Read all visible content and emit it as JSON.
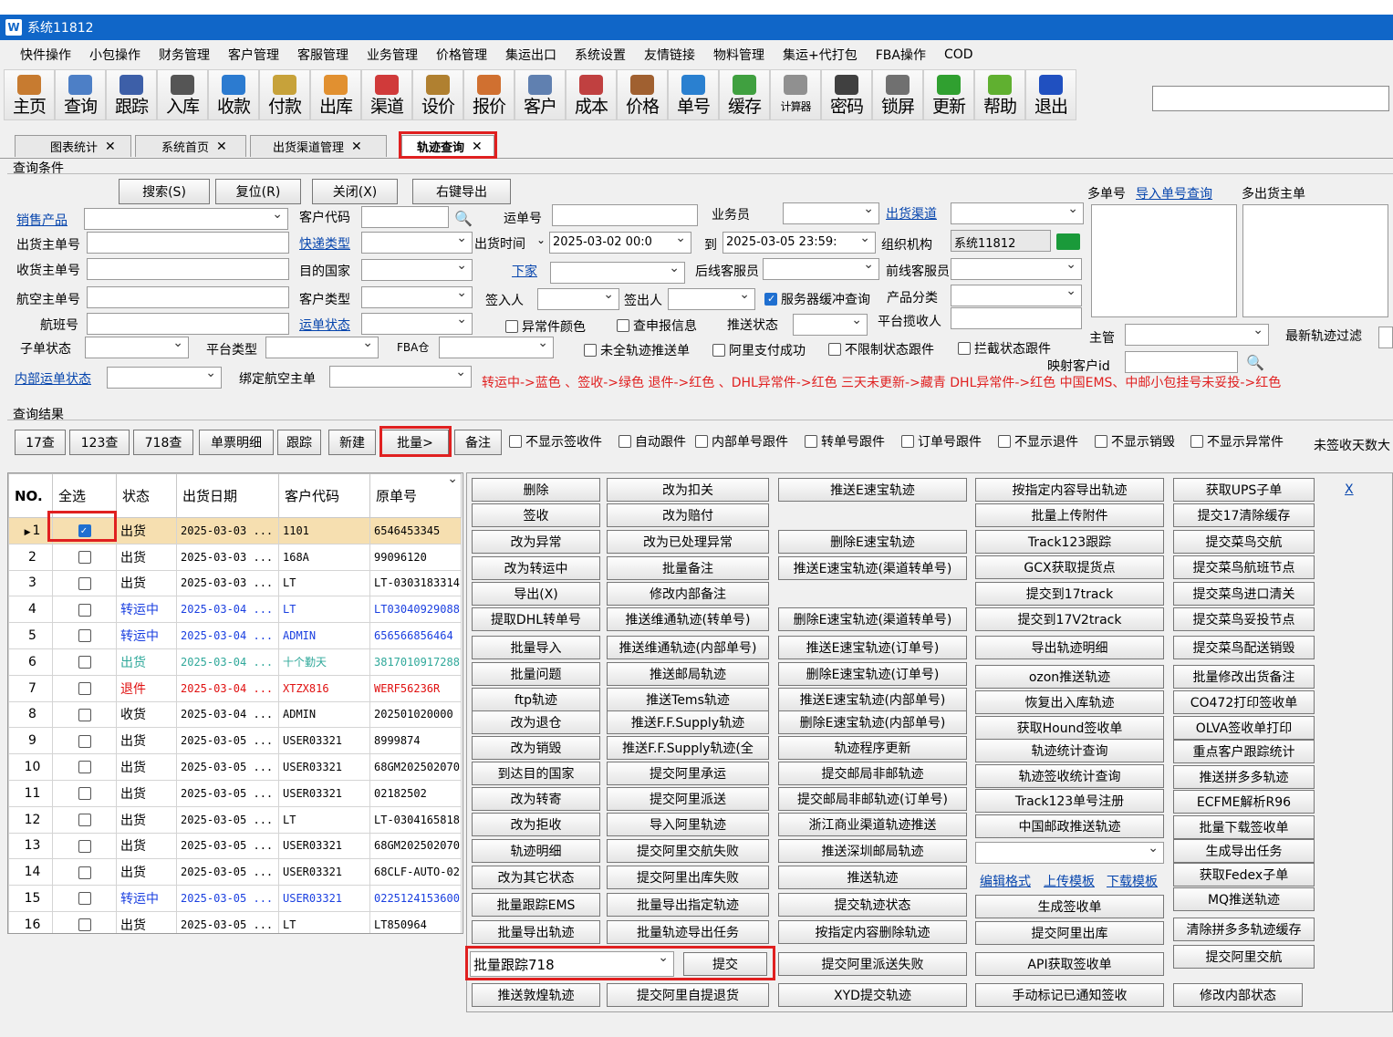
{
  "window": {
    "title": "系统11812",
    "icon_letter": "W"
  },
  "menu": [
    "快件操作",
    "小包操作",
    "财务管理",
    "客户管理",
    "客服管理",
    "业务管理",
    "价格管理",
    "集运出口",
    "系统设置",
    "友情链接",
    "物料管理",
    "集运+代打包",
    "FBA操作",
    "COD"
  ],
  "toolbar": [
    {
      "label": "主页",
      "icon": "home-icon",
      "color": "#c77b30"
    },
    {
      "label": "查询",
      "icon": "magnifier-icon",
      "color": "#4d7fc6"
    },
    {
      "label": "跟踪",
      "icon": "wifi-icon",
      "color": "#3d5fa8"
    },
    {
      "label": "入库",
      "icon": "hammer-icon",
      "color": "#555555"
    },
    {
      "label": "收款",
      "icon": "yen-icon",
      "color": "#2c7bd0"
    },
    {
      "label": "付款",
      "icon": "money-icon",
      "color": "#c7a23a"
    },
    {
      "label": "出库",
      "icon": "mail-icon",
      "color": "#e19030"
    },
    {
      "label": "渠道",
      "icon": "cycle-icon",
      "color": "#d03a3a"
    },
    {
      "label": "设价",
      "icon": "scale-icon",
      "color": "#b08030"
    },
    {
      "label": "报价",
      "icon": "note-icon",
      "color": "#d07030"
    },
    {
      "label": "客户",
      "icon": "people-icon",
      "color": "#6080b0"
    },
    {
      "label": "成本",
      "icon": "chart-icon",
      "color": "#c04040"
    },
    {
      "label": "价格",
      "icon": "calendar-icon",
      "color": "#a06030"
    },
    {
      "label": "单号",
      "icon": "eye-icon",
      "color": "#2a80d0"
    },
    {
      "label": "缓存",
      "icon": "refresh-icon",
      "color": "#40a040"
    },
    {
      "label": "计算器",
      "icon": "calculator-icon",
      "color": "#909090"
    },
    {
      "label": "密码",
      "icon": "key-icon",
      "color": "#404040"
    },
    {
      "label": "锁屏",
      "icon": "lock-icon",
      "color": "#707070"
    },
    {
      "label": "更新",
      "icon": "download-icon",
      "color": "#30a030"
    },
    {
      "label": "帮助",
      "icon": "help-icon",
      "color": "#60b030"
    },
    {
      "label": "退出",
      "icon": "power-icon",
      "color": "#2050c0"
    }
  ],
  "tabs": [
    {
      "label": "图表统计",
      "active": false
    },
    {
      "label": "系统首页",
      "active": false
    },
    {
      "label": "出货渠道管理",
      "active": false
    },
    {
      "label": "轨迹查询",
      "active": true
    }
  ],
  "query": {
    "section_title": "查询条件",
    "search_btn": "搜索(S)",
    "reset_btn": "复位(R)",
    "close_btn": "关闭(X)",
    "export_btn": "右键导出",
    "sales_product": "销售产品",
    "customer_code": "客户代码",
    "waybill_no": "运单号",
    "salesman": "业务员",
    "ship_channel": "出货渠道",
    "ship_master_no": "出货主单号",
    "express_type": "快递类型",
    "ship_time": "出货时间",
    "date_from": "2025-03-02 00:0",
    "to": "到",
    "date_to": "2025-03-05 23:59:",
    "org": "组织机构",
    "org_value": "系统11812",
    "recv_master_no": "收货主单号",
    "dest_country": "目的国家",
    "downstream": "下家",
    "back_cs": "后线客服员",
    "front_cs": "前线客服员",
    "air_master_no": "航空主单号",
    "customer_type": "客户类型",
    "signer_in": "签入人",
    "signer_out": "签出人",
    "server_cache": "服务器缓冲查询",
    "product_cat": "产品分类",
    "flight_no": "航班号",
    "waybill_status": "运单状态",
    "exception_color": "异常件颜色",
    "check_report": "查申报信息",
    "push_status": "推送状态",
    "platform_receiver": "平台揽收人",
    "sub_status": "子单状态",
    "platform_type": "平台类型",
    "fba_warehouse": "FBA仓",
    "incomplete_push": "未全轨迹推送单",
    "ali_pay_ok": "阿里支付成功",
    "no_limit_status": "不限制状态跟件",
    "intercept_status": "拦截状态跟件",
    "internal_waybill_status": "内部运单状态",
    "bind_air_master": "绑定航空主单",
    "multi_no": "多单号",
    "import_query": "导入单号查询",
    "multi_ship_master": "多出货主单",
    "supervisor": "主管",
    "latest_track_filter": "最新轨迹过滤",
    "mapped_customer_id": "映射客户id",
    "legend": "转运中->蓝色 、签收->绿色  退件->红色 、DHL异常件->红色 三天未更新->藏青 DHL异常件->红色  中国EMS、中邮小包挂号未妥投->红色"
  },
  "results": {
    "section_title": "查询结果",
    "buttons": [
      "17查",
      "123查",
      "718查",
      "单票明细",
      "跟踪",
      "新建",
      "批量>",
      "备注"
    ],
    "checks": [
      "不显示签收件",
      "自动跟件",
      "内部单号跟件",
      "转单号跟件",
      "订单号跟件",
      "不显示退件",
      "不显示销毁",
      "不显示异常件"
    ],
    "unsigned_days": "未签收天数大"
  },
  "grid": {
    "headers": [
      "NO.",
      "全选",
      "状态",
      "出货日期",
      "客户代码",
      "原单号"
    ],
    "rows": [
      {
        "no": "1",
        "checked": true,
        "status": "出货",
        "date": "2025-03-03 ...",
        "code": "1101",
        "orig": "6546453345",
        "color": "#000000"
      },
      {
        "no": "2",
        "checked": false,
        "status": "出货",
        "date": "2025-03-03 ...",
        "code": "168A",
        "orig": "99096120",
        "color": "#000000"
      },
      {
        "no": "3",
        "checked": false,
        "status": "出货",
        "date": "2025-03-03 ...",
        "code": "LT",
        "orig": "LT-0303183314",
        "color": "#000000"
      },
      {
        "no": "4",
        "checked": false,
        "status": "转运中",
        "date": "2025-03-04 ...",
        "code": "LT",
        "orig": "LT03040929088",
        "color": "#1a3fe0"
      },
      {
        "no": "5",
        "checked": false,
        "status": "转运中",
        "date": "2025-03-04 ...",
        "code": "ADMIN",
        "orig": "656566856464",
        "color": "#1a3fe0"
      },
      {
        "no": "6",
        "checked": false,
        "status": "出货",
        "date": "2025-03-04 ...",
        "code": "十个勤天",
        "orig": "3817010917288",
        "color": "#2fa89a"
      },
      {
        "no": "7",
        "checked": false,
        "status": "退件",
        "date": "2025-03-04 ...",
        "code": "XTZX816",
        "orig": "WERF56236R",
        "color": "#e01010"
      },
      {
        "no": "8",
        "checked": false,
        "status": "收货",
        "date": "2025-03-04 ...",
        "code": "ADMIN",
        "orig": "202501020000",
        "color": "#000000"
      },
      {
        "no": "9",
        "checked": false,
        "status": "出货",
        "date": "2025-03-05 ...",
        "code": "USER03321",
        "orig": "8999874",
        "color": "#000000"
      },
      {
        "no": "10",
        "checked": false,
        "status": "出货",
        "date": "2025-03-05 ...",
        "code": "USER03321",
        "orig": "68GM202502070",
        "color": "#000000"
      },
      {
        "no": "11",
        "checked": false,
        "status": "出货",
        "date": "2025-03-05 ...",
        "code": "USER03321",
        "orig": "02182502",
        "color": "#000000"
      },
      {
        "no": "12",
        "checked": false,
        "status": "出货",
        "date": "2025-03-05 ...",
        "code": "LT",
        "orig": "LT-0304165818",
        "color": "#000000"
      },
      {
        "no": "13",
        "checked": false,
        "status": "出货",
        "date": "2025-03-05 ...",
        "code": "USER03321",
        "orig": "68GM202502070",
        "color": "#000000"
      },
      {
        "no": "14",
        "checked": false,
        "status": "出货",
        "date": "2025-03-05 ...",
        "code": "USER03321",
        "orig": "68CLF-AUTO-02",
        "color": "#000000"
      },
      {
        "no": "15",
        "checked": false,
        "status": "转运中",
        "date": "2025-03-05 ...",
        "code": "USER03321",
        "orig": "0225124153600",
        "color": "#1a3fe0"
      },
      {
        "no": "16",
        "checked": false,
        "status": "出货",
        "date": "2025-03-05 ...",
        "code": "LT",
        "orig": "LT850964",
        "color": "#000000"
      }
    ]
  },
  "batch_menu": {
    "close": "X",
    "col1": [
      "删除",
      "签收",
      "改为异常",
      "改为转运中",
      "导出(X)",
      "提取DHL转单号",
      "批量导入",
      "批量问题",
      "ftp轨迹",
      "改为退仓",
      "改为销毁",
      "到达目的国家",
      "改为转寄",
      "改为拒收",
      "轨迹明细",
      "改为其它状态",
      "批量跟踪EMS",
      "批量导出轨迹"
    ],
    "col2": [
      "改为扣关",
      "改为赔付",
      "改为已处理异常",
      "批量备注",
      "修改内部备注",
      "推送维通轨迹(转单号)",
      "推送维通轨迹(内部单号)",
      "推送邮局轨迹",
      "推送Tems轨迹",
      "推送F.F.Supply轨迹",
      "推送F.F.Supply轨迹(全",
      "提交阿里承运",
      "提交阿里派送",
      "导入阿里轨迹",
      "提交阿里交航失败",
      "提交阿里出库失败",
      "批量导出指定轨迹",
      "批量轨迹导出任务"
    ],
    "col3": [
      "推送E速宝轨迹",
      "",
      "删除E速宝轨迹",
      "推送E速宝轨迹(渠道转单号)",
      "",
      "删除E速宝轨迹(渠道转单号)",
      "推送E速宝轨迹(订单号)",
      "删除E速宝轨迹(订单号)",
      "推送E速宝轨迹(内部单号)",
      "删除E速宝轨迹(内部单号)",
      "轨迹程序更新",
      "提交邮局非邮轨迹",
      "提交邮局非邮轨迹(订单号)",
      "浙江商业渠道轨迹推送",
      "推送深圳邮局轨迹",
      "推送轨迹",
      "提交轨迹状态",
      "按指定内容删除轨迹"
    ],
    "col4": [
      "按指定内容导出轨迹",
      "批量上传附件",
      "Track123跟踪",
      "GCX获取提货点",
      "提交到17track",
      "提交到17V2track",
      "导出轨迹明细",
      "ozon推送轨迹",
      "恢复出入库轨迹",
      "获取Hound签收单",
      "轨迹统计查询",
      "轨迹签收统计查询",
      "Track123单号注册",
      "中国邮政推送轨迹"
    ],
    "col4_links": [
      "编辑格式",
      "上传模板",
      "下载模板"
    ],
    "col4b": [
      "生成签收单",
      "提交阿里出库"
    ],
    "col5": [
      "获取UPS子单",
      "提交17清除缓存",
      "提交菜鸟交航",
      "提交菜鸟航班节点",
      "提交菜鸟进口清关",
      "提交菜鸟妥投节点",
      "提交菜鸟配送销毁",
      "批量修改出货备注",
      "CO472打印签收单",
      "OLVA签收单打印",
      "重点客户跟踪统计",
      "推送拼多多轨迹",
      "ECFME解析R96",
      "批量下载签收单",
      "生成导出任务",
      "获取Fedex子单",
      "MQ推送轨迹",
      "清除拼多多轨迹缓存",
      "提交阿里交航"
    ],
    "batch_select": "批量跟踪718",
    "submit": "提交",
    "row_last": [
      "推送敦煌轨迹",
      "提交阿里自提退货",
      "XYD提交轨迹",
      "手动标记已通知签收",
      "修改内部状态"
    ],
    "row_mid": [
      "提交阿里派送失败",
      "API获取签收单"
    ]
  }
}
